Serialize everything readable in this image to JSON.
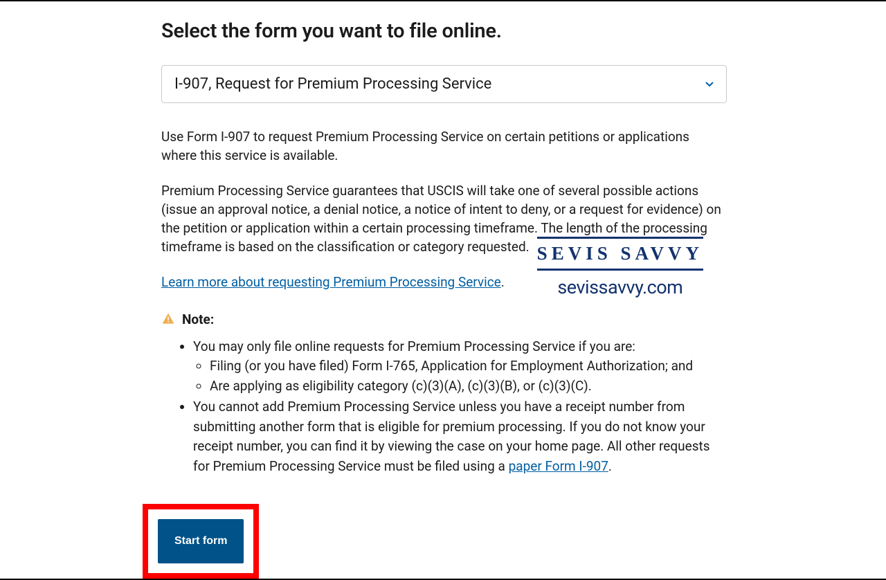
{
  "title": "Select the form you want to file online.",
  "select": {
    "value": "I-907, Request for Premium Processing Service"
  },
  "paragraphs": {
    "p1": "Use Form I-907 to request Premium Processing Service on certain petitions or applications where this service is available.",
    "p2": "Premium Processing Service guarantees that USCIS will take one of several possible actions (issue an approval notice, a denial notice, a notice of intent to deny, or a request for evidence) on the petition or application within a certain processing timeframe. The length of the processing timeframe is based on the classification or category requested."
  },
  "learn_more": {
    "text": "Learn more about requesting Premium Processing Service",
    "suffix": "."
  },
  "note_label": "Note:",
  "bullets": {
    "b1": "You may only file online requests for Premium Processing Service if you are:",
    "b1a": "Filing (or you have filed) Form I-765, Application for Employment Authorization; and",
    "b1b": "Are applying as eligibility category (c)(3)(A), (c)(3)(B), or (c)(3)(C).",
    "b2_pre": "You cannot add Premium Processing Service unless you have a receipt number from submitting another form that is eligible for premium processing. If you do not know your receipt number, you can find it by viewing the case on your home page. All other requests for Premium Processing Service must be filed using a ",
    "b2_link": "paper Form I-907",
    "b2_post": "."
  },
  "start_button": "Start form",
  "watermark": {
    "name": "SEVIS SAVVY",
    "url": "sevissavvy.com"
  }
}
